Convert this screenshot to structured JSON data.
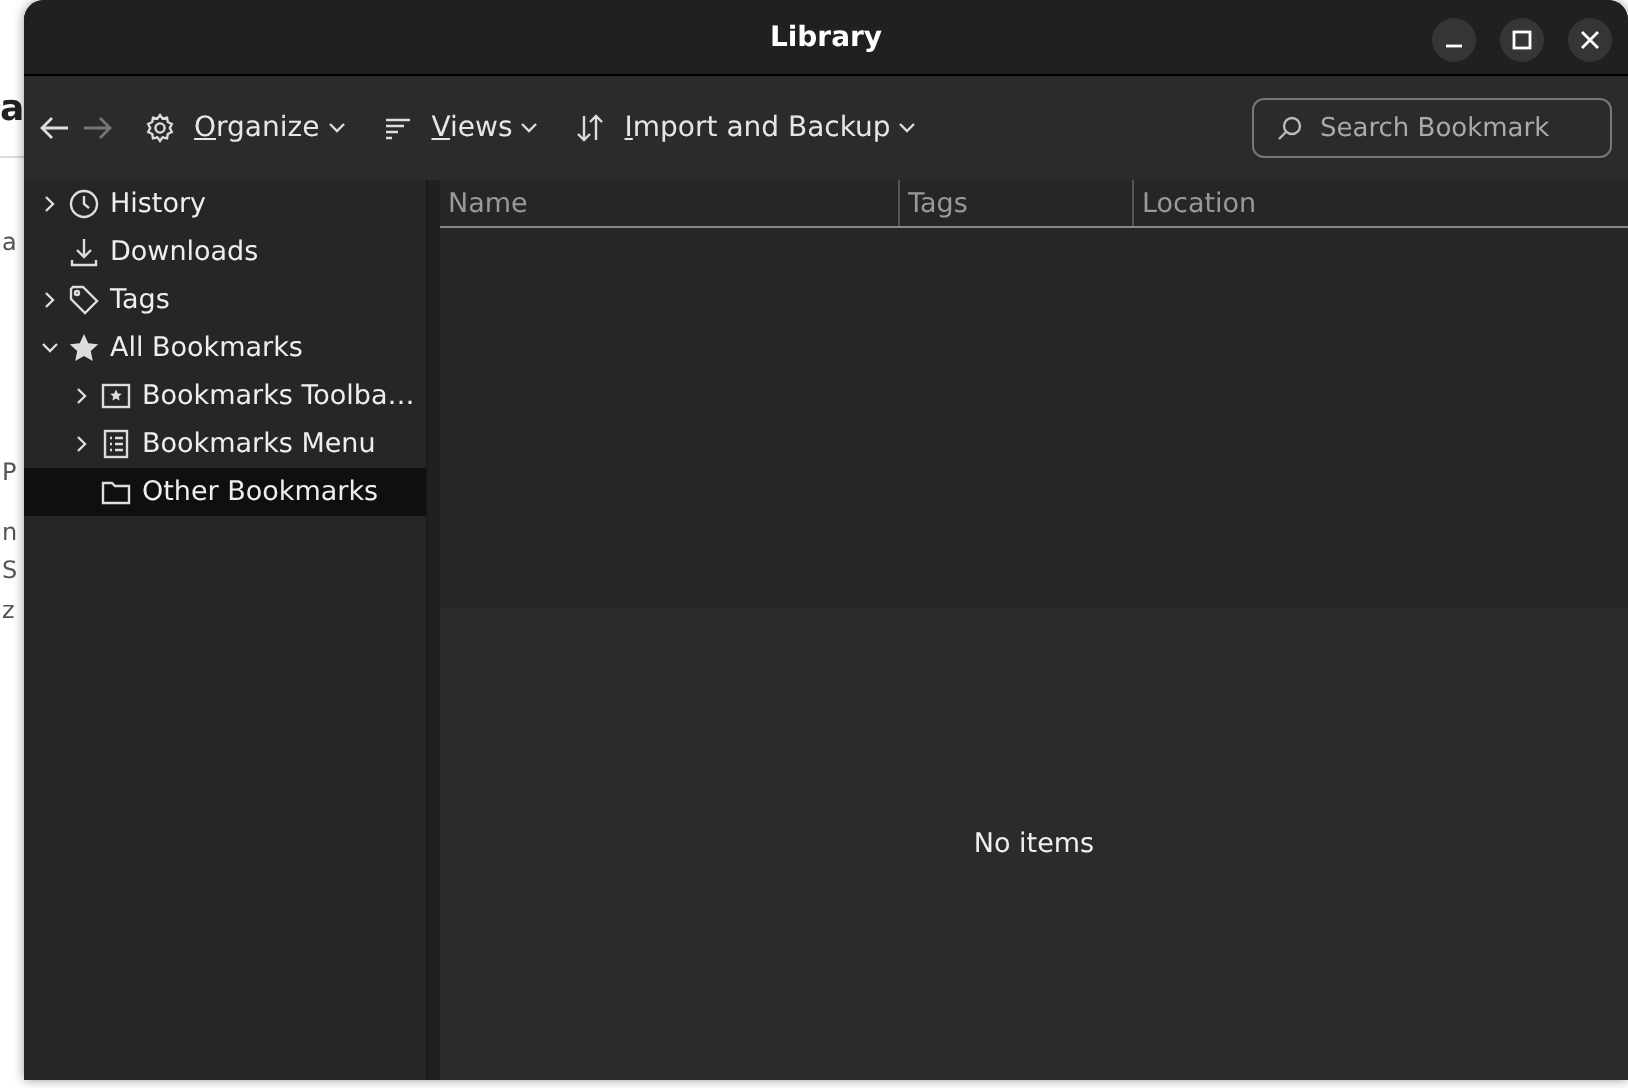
{
  "background_page": {
    "fragments": [
      {
        "text": "a",
        "kind": "heading"
      },
      {
        "text": "a",
        "kind": "text"
      },
      {
        "text": "P",
        "kind": "text"
      },
      {
        "text": "n",
        "kind": "text"
      },
      {
        "text": "S",
        "kind": "text"
      },
      {
        "text": "z",
        "kind": "text"
      }
    ]
  },
  "window": {
    "title": "Library"
  },
  "toolbar": {
    "back_disabled": false,
    "forward_disabled": true,
    "items": [
      {
        "label": "Organize",
        "kind": "organize"
      },
      {
        "label": "Views",
        "kind": "views"
      },
      {
        "label": "Import and Backup",
        "kind": "import"
      }
    ]
  },
  "search": {
    "placeholder": "Search Bookmark"
  },
  "sidebar": {
    "items": [
      {
        "label": "History",
        "kind": "history",
        "expandable": true,
        "expanded": false,
        "selected": false
      },
      {
        "label": "Downloads",
        "kind": "downloads",
        "expandable": false,
        "selected": false
      },
      {
        "label": "Tags",
        "kind": "tags",
        "expandable": true,
        "expanded": false,
        "selected": false
      },
      {
        "label": "All Bookmarks",
        "kind": "all",
        "expandable": true,
        "expanded": true,
        "selected": false,
        "children": [
          {
            "label": "Bookmarks Toolba…",
            "kind": "toolbar",
            "expandable": true,
            "expanded": false,
            "selected": false
          },
          {
            "label": "Bookmarks Menu",
            "kind": "menu",
            "expandable": true,
            "expanded": false,
            "selected": false
          },
          {
            "label": "Other Bookmarks",
            "kind": "folder",
            "expandable": false,
            "selected": true
          }
        ]
      }
    ]
  },
  "table": {
    "columns": [
      "Name",
      "Tags",
      "Location"
    ]
  },
  "details": {
    "message": "No items"
  }
}
